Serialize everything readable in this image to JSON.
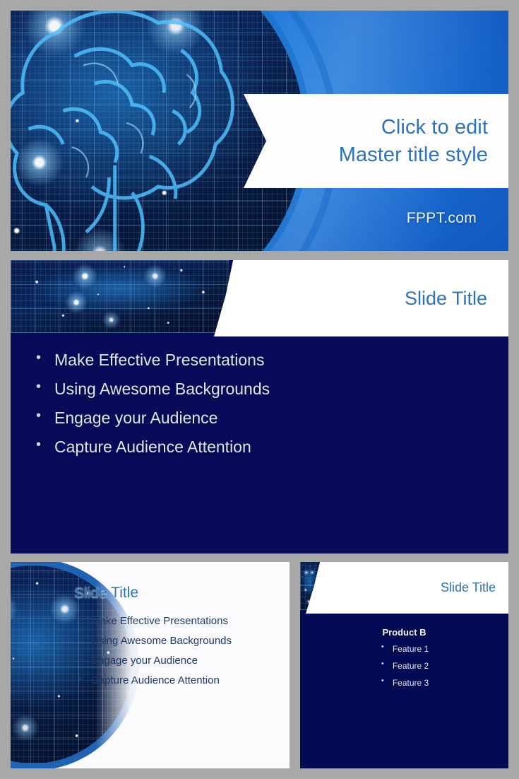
{
  "theme": {
    "accent_blue": "#2e74b5",
    "navy": "#080b5a",
    "navy_alt": "#030a54",
    "page_background": "#a8a8a8",
    "banner_white": "#ffffff"
  },
  "slide1": {
    "title_line1": "Click to edit",
    "title_line2": "Master title style",
    "brand": "FPPT.com",
    "background_image_name": "digital-brain-circuit-board"
  },
  "slide2": {
    "title": "Slide Title",
    "bullets": [
      "Make Effective Presentations",
      "Using Awesome Backgrounds",
      "Engage your Audience",
      "Capture Audience Attention"
    ]
  },
  "slide3": {
    "title": "Slide Title",
    "bullets": [
      "Make Effective Presentations",
      "Using Awesome Backgrounds",
      "Engage your Audience",
      "Capture Audience Attention"
    ]
  },
  "slide4": {
    "title": "Slide Title",
    "product_heading": "Product B",
    "bullets": [
      "Feature 1",
      "Feature 2",
      "Feature 3"
    ]
  }
}
